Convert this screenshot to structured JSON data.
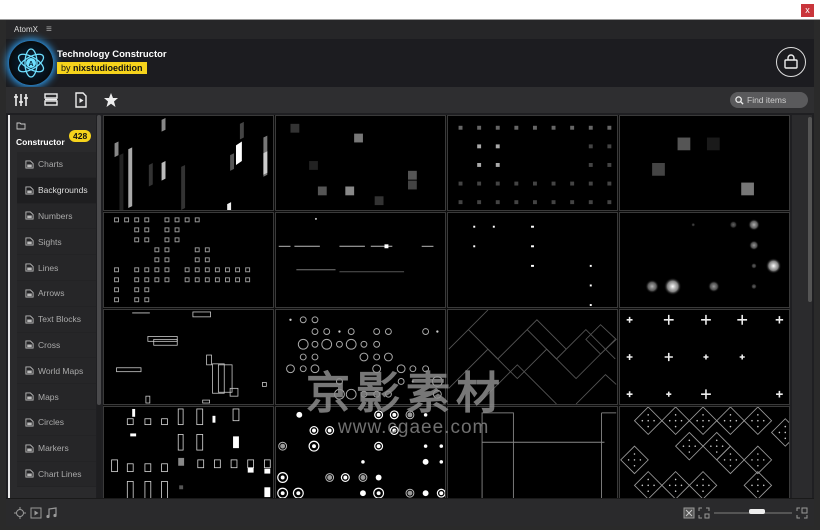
{
  "window": {
    "app_name": "AtomX",
    "close_label": "x"
  },
  "header": {
    "title": "Technology Constructor",
    "author_prefix": "by",
    "author": "nixstudioedition"
  },
  "toolbar": {
    "icons": [
      "sliders-icon",
      "layout-icon",
      "media-file-icon",
      "star-icon"
    ],
    "search_placeholder": "Find items"
  },
  "sidebar": {
    "section_label": "Constructor",
    "count": "428",
    "items": [
      {
        "label": "Charts",
        "active": false
      },
      {
        "label": "Backgrounds",
        "active": true
      },
      {
        "label": "Numbers",
        "active": false
      },
      {
        "label": "Sights",
        "active": false
      },
      {
        "label": "Lines",
        "active": false
      },
      {
        "label": "Arrows",
        "active": false
      },
      {
        "label": "Text Blocks",
        "active": false
      },
      {
        "label": "Cross",
        "active": false
      },
      {
        "label": "World Maps",
        "active": false
      },
      {
        "label": "Maps",
        "active": false
      },
      {
        "label": "Circles",
        "active": false
      },
      {
        "label": "Markers",
        "active": false
      },
      {
        "label": "Chart Lines",
        "active": false
      }
    ]
  },
  "grid": {
    "thumbnails": [
      "background-slanted-bars",
      "background-gray-squares",
      "background-dot-grid",
      "background-large-squares",
      "background-square-dot-matrix",
      "background-scan-lines",
      "background-white-dots",
      "background-glow-orbs",
      "background-outline-boxes",
      "background-ring-circles",
      "background-diagonal-tiles",
      "background-plus-marks",
      "background-rect-blocks",
      "background-target-circles",
      "background-frame-lines",
      "background-diamond-dice"
    ]
  },
  "watermark": {
    "line1": "京影素材",
    "line2": "www.cgaee.com"
  },
  "footer": {
    "left_icons": [
      "target-icon",
      "play-icon",
      "music-icon"
    ],
    "right_icons": [
      "fit-icon",
      "shrink-icon",
      "expand-icon"
    ],
    "zoom_level": 0.55
  }
}
